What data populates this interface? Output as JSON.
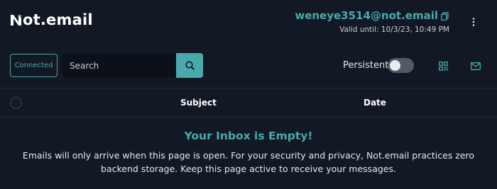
{
  "header": {
    "logo_text": "ot.email",
    "logo_full": "Not.email",
    "email_address": "weneye3514@not.email",
    "valid_until": "Valid until: 10/3/23, 10:49 PM"
  },
  "toolbar": {
    "status_label": "Connected",
    "search_placeholder": "Search",
    "persistent_label": "Persistent",
    "persistent_enabled": false
  },
  "table": {
    "columns": [
      "Subject",
      "Date"
    ]
  },
  "empty_state": {
    "title": "Your Inbox is Empty!",
    "message": "Emails will only arrive when this page is open. For your security and privacy, Not.email practices zero backend storage. Keep this page active to receive your messages."
  },
  "icons": {
    "copy": "copy-icon",
    "more": "more-vertical-icon",
    "search": "search-icon",
    "qr": "qr-code-icon",
    "mail": "mail-icon"
  },
  "colors": {
    "accent": "#4aa9ab",
    "background": "#121924"
  }
}
